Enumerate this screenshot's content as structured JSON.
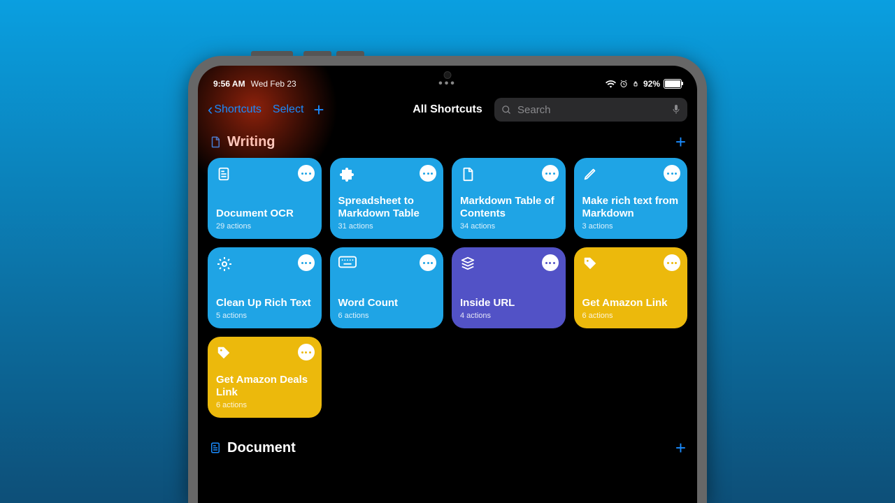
{
  "status": {
    "time": "9:56 AM",
    "date": "Wed Feb 23",
    "battery_pct": "92%"
  },
  "nav": {
    "back_label": "Shortcuts",
    "select_label": "Select",
    "title": "All Shortcuts",
    "search_placeholder": "Search"
  },
  "sections": [
    {
      "title": "Writing",
      "icon": "document",
      "tiles": [
        {
          "title": "Document OCR",
          "sub": "29 actions",
          "color": "#1fa4e5",
          "icon": "scan-doc"
        },
        {
          "title": "Spreadsheet to Markdown Table",
          "sub": "31 actions",
          "color": "#1fa4e5",
          "icon": "puzzle"
        },
        {
          "title": "Markdown Table of Contents",
          "sub": "34 actions",
          "color": "#1fa4e5",
          "icon": "document"
        },
        {
          "title": "Make rich text from Markdown",
          "sub": "3 actions",
          "color": "#1fa4e5",
          "icon": "pencil"
        },
        {
          "title": "Clean Up Rich Text",
          "sub": "5 actions",
          "color": "#1fa4e5",
          "icon": "gear"
        },
        {
          "title": "Word Count",
          "sub": "6 actions",
          "color": "#1fa4e5",
          "icon": "keyboard"
        },
        {
          "title": "Inside URL",
          "sub": "4 actions",
          "color": "#5252c6",
          "icon": "stack"
        },
        {
          "title": "Get Amazon Link",
          "sub": "6 actions",
          "color": "#ecb90c",
          "icon": "tag"
        },
        {
          "title": "Get Amazon Deals Link",
          "sub": "6 actions",
          "color": "#ecb90c",
          "icon": "tag"
        }
      ]
    },
    {
      "title": "Document",
      "icon": "scan-doc",
      "tiles": []
    }
  ]
}
